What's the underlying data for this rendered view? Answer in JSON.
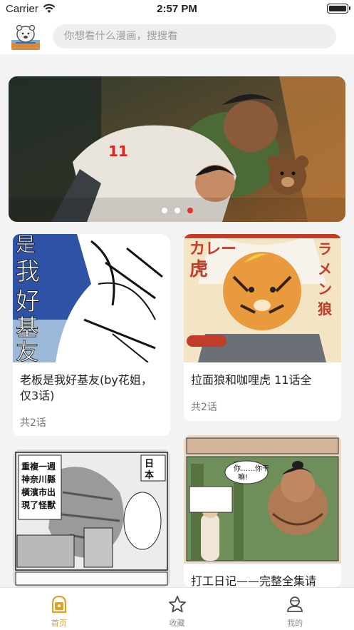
{
  "status_bar": {
    "carrier": "Carrier",
    "time": "2:57 PM",
    "battery_level": 1.0
  },
  "search": {
    "placeholder": "你想看什么漫画，搜搜看"
  },
  "banner": {
    "dots_count": 3,
    "active_index": 2
  },
  "comics": [
    {
      "title": "老板是我好基友(by花姐，仅3话)",
      "count": "共2话",
      "thumb_text": "是我好基友"
    },
    {
      "title": "拉面狼和咖哩虎 11话全",
      "count": "共2话",
      "thumb_text": "ラーメン狼と カレー虎"
    },
    {
      "title": "",
      "count": "",
      "thumb_text": "重複一週 神奈川縣 橫濱市出現了怪獸"
    },
    {
      "title": "打工日记——完整全集请",
      "count": "",
      "thumb_text": "你……你干嘛!"
    }
  ],
  "tabbar": {
    "items": [
      {
        "label": "首页",
        "icon": "home-icon",
        "active": true
      },
      {
        "label": "收藏",
        "icon": "star-icon",
        "active": false
      },
      {
        "label": "我的",
        "icon": "profile-icon",
        "active": false
      }
    ]
  },
  "colors": {
    "accent": "#e0a12b",
    "dot_active": "#e5322d",
    "background": "#f3f3f3"
  }
}
